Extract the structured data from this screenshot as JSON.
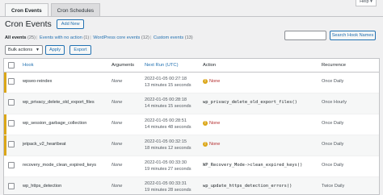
{
  "tabs": [
    {
      "label": "Cron Events",
      "active": true
    },
    {
      "label": "Cron Schedules",
      "active": false
    }
  ],
  "help_label": "Help ▾",
  "page_title": "Cron Events",
  "add_new_label": "Add New",
  "filters": [
    {
      "label": "All events",
      "count": "(25)"
    },
    {
      "label": "Events with no action",
      "count": "(1)"
    },
    {
      "label": "WordPress core events",
      "count": "(12)"
    },
    {
      "label": "Custom events",
      "count": "(13)"
    }
  ],
  "search": {
    "placeholder": "",
    "button_label": "Search Hook Names"
  },
  "bulk_actions": {
    "selected": "Bulk actions",
    "apply_label": "Apply",
    "export_label": "Export"
  },
  "columns": {
    "hook": "Hook",
    "arguments": "Arguments",
    "next_run": "Next Run (UTC)",
    "action": "Action",
    "recurrence": "Recurrence"
  },
  "rows": [
    {
      "hook": "wpseo-reindex",
      "arguments": "None",
      "next_run_date": "2022-01-05 00:27:18",
      "next_run_rel": "13 minutes 15 seconds",
      "action": "None",
      "action_warning": true,
      "recurrence": "Once Daily"
    },
    {
      "hook": "wp_privacy_delete_old_export_files",
      "arguments": "None",
      "next_run_date": "2022-01-05 00:28:18",
      "next_run_rel": "14 minutes 15 seconds",
      "action": "wp_privacy_delete_old_export_files()",
      "action_warning": false,
      "recurrence": "Once Hourly"
    },
    {
      "hook": "wp_session_garbage_collection",
      "arguments": "None",
      "next_run_date": "2022-01-05 00:28:51",
      "next_run_rel": "14 minutes 48 seconds",
      "action": "None",
      "action_warning": true,
      "recurrence": "Once Daily"
    },
    {
      "hook": "jetpack_v2_heartbeat",
      "arguments": "None",
      "next_run_date": "2022-01-05 00:32:15",
      "next_run_rel": "18 minutes 12 seconds",
      "action": "None",
      "action_warning": true,
      "recurrence": "Once Daily"
    },
    {
      "hook": "recovery_mode_clean_expired_keys",
      "arguments": "None",
      "next_run_date": "2022-01-05 00:33:30",
      "next_run_rel": "19 minutes 27 seconds",
      "action": "WP_Recovery_Mode->clean_expired_keys()",
      "action_warning": false,
      "recurrence": "Once Daily"
    },
    {
      "hook": "wp_https_detection",
      "arguments": "None",
      "next_run_date": "2022-01-05 00:33:31",
      "next_run_rel": "19 minutes 28 seconds",
      "action": "wp_update_https_detection_errors()",
      "action_warning": false,
      "recurrence": "Twice Daily"
    }
  ]
}
